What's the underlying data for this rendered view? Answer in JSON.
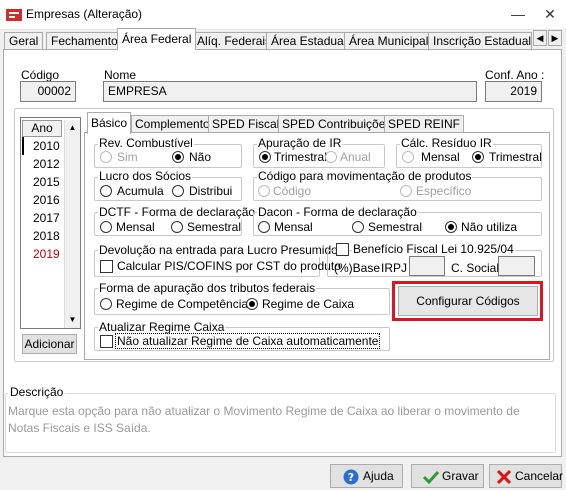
{
  "window": {
    "title": "Empresas (Alteração)",
    "minimize_glyph": "—",
    "maximize_glyph": "□",
    "close_glyph": "✕"
  },
  "top_tabs": [
    "Geral",
    "Fechamento",
    "Área Federal",
    "Alíq. Federais",
    "Área Estadual",
    "Área Municipal",
    "Inscrição Estadual S"
  ],
  "top_tabs_active": "Área Federal",
  "header": {
    "codigo_label": "Código",
    "codigo_value": "00002",
    "nome_label": "Nome",
    "nome_value": "EMPRESA",
    "conf_ano_label": "Conf. Ano :",
    "conf_ano_value": "2019"
  },
  "years": {
    "header": "Ano",
    "items": [
      "2010",
      "2012",
      "2015",
      "2016",
      "2017",
      "2018",
      "2019"
    ],
    "selected": "2019",
    "add_button": "Adicionar"
  },
  "inner_tabs": [
    "Básico",
    "Complemento",
    "SPED Fiscal",
    "SPED Contribuições",
    "SPED REINF"
  ],
  "inner_tabs_active": "Básico",
  "basico": {
    "rev_combustivel": {
      "title": "Rev. Combustível",
      "options": [
        "Sim",
        "Não"
      ],
      "selected": "Não"
    },
    "apuracao_ir": {
      "title": "Apuração de IR",
      "options": [
        "Trimestral",
        "Anual"
      ],
      "selected": "Trimestral"
    },
    "calc_residuo_ir": {
      "title": "Cálc. Resíduo IR",
      "options": [
        "Mensal",
        "Trimestral"
      ],
      "selected": "Trimestral"
    },
    "lucro_socios": {
      "title": "Lucro dos Sócios",
      "options": [
        "Acumula",
        "Distribui"
      ],
      "selected": ""
    },
    "codigo_mov_produtos": {
      "title": "Código para movimentação de produtos",
      "options": [
        "Código",
        "Específico"
      ],
      "selected": ""
    },
    "dctf": {
      "title": "DCTF - Forma de declaração",
      "options": [
        "Mensal",
        "Semestral"
      ],
      "selected": ""
    },
    "dacon": {
      "title": "Dacon - Forma de declaração",
      "options": [
        "Mensal",
        "Semestral",
        "Não utiliza"
      ],
      "selected": "Não utiliza"
    },
    "devolucao": {
      "title": "Devolução na entrada para Lucro Presumido",
      "checkbox_label": "Calcular PIS/COFINS por CST do produto",
      "checked": false
    },
    "beneficio": {
      "checkbox_label": "Benefício Fiscal Lei 10.925/04",
      "checked": false,
      "base_label": "(%)Base",
      "irpj_label": "IRPJ",
      "csocial_label": "C. Social",
      "irpj_value": "",
      "csocial_value": ""
    },
    "forma_apuracao": {
      "title": "Forma de apuração dos tributos federais",
      "options": [
        "Regime de Competência",
        "Regime de Caixa"
      ],
      "selected": "Regime de Caixa"
    },
    "configurar_button": "Configurar Códigos",
    "atualizar_regime": {
      "title": "Atualizar Regime Caixa",
      "checkbox_label": "Não atualizar Regime de Caixa automaticamente",
      "checked": false
    }
  },
  "descricao": {
    "title": "Descrição",
    "text": "Marque esta opção para não atualizar o Movimento Regime de Caixa ao liberar o movimento de Notas Fiscais e ISS Saída."
  },
  "footer": {
    "help": "Ajuda",
    "save": "Gravar",
    "cancel": "Cancelar"
  },
  "colors": {
    "highlight_box": "#e0141e",
    "selected_year": "#c00000",
    "help_icon": "#2a6fcf",
    "save_icon": "#2e9a2e",
    "cancel_icon": "#d11"
  }
}
